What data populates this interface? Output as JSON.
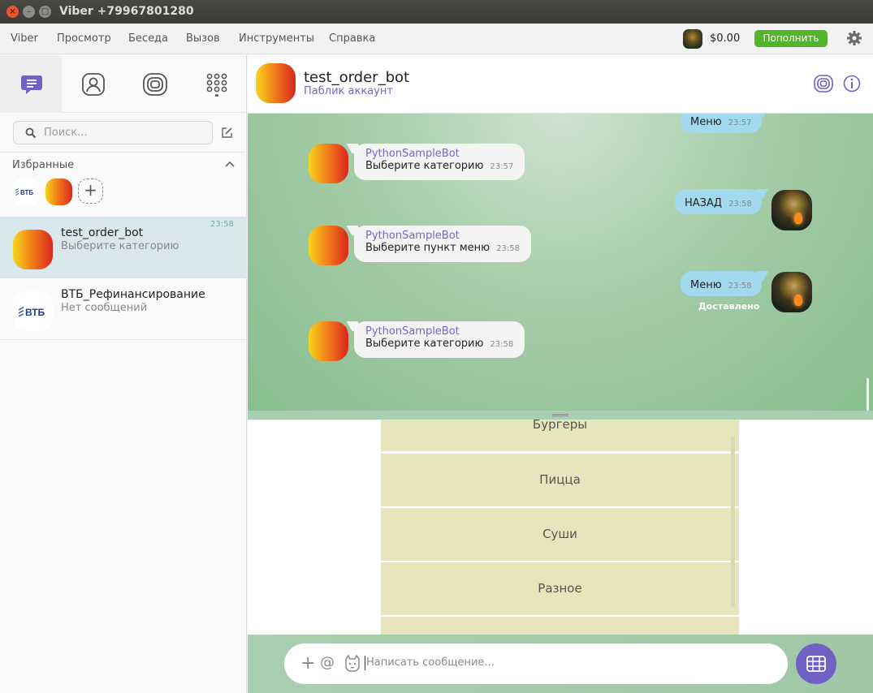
{
  "window": {
    "title": "Viber +79967801280"
  },
  "menu": {
    "items": [
      "Viber",
      "Просмотр",
      "Беседа",
      "Вызов",
      "Инструменты",
      "Справка"
    ],
    "balance": "$0.00",
    "topup_label": "Пополнить"
  },
  "sidebar": {
    "tabs": [
      {
        "icon": "chats-icon"
      },
      {
        "icon": "contacts-icon"
      },
      {
        "icon": "public-accounts-icon"
      },
      {
        "icon": "dialpad-icon"
      }
    ],
    "search_placeholder": "Поиск...",
    "favorites_label": "Избранные",
    "vtb_logo_text": "ВТБ",
    "chats": [
      {
        "name": "test_order_bot",
        "preview": "Выберите категорию",
        "time": "23:58",
        "active": true
      },
      {
        "name": "ВТБ_Рефинансирование",
        "preview": "Нет сообщений",
        "time": "",
        "active": false
      }
    ]
  },
  "chat": {
    "name": "test_order_bot",
    "subtitle": "Паблик аккаунт",
    "messages": [
      {
        "dir": "out",
        "text": "Меню",
        "time": "23:57"
      },
      {
        "dir": "in",
        "sender": "PythonSampleBot",
        "text": "Выберите категорию",
        "time": "23:57"
      },
      {
        "dir": "out",
        "text": "НАЗАД",
        "time": "23:58"
      },
      {
        "dir": "in",
        "sender": "PythonSampleBot",
        "text": "Выберите пункт меню",
        "time": "23:58"
      },
      {
        "dir": "out",
        "text": "Меню",
        "time": "23:58"
      },
      {
        "dir": "in",
        "sender": "PythonSampleBot",
        "text": "Выберите категорию",
        "time": "23:58"
      }
    ],
    "delivered_label": "Доставлено"
  },
  "keyboard": {
    "buttons": [
      "Бургеры",
      "Пицца",
      "Суши",
      "Разное",
      ""
    ]
  },
  "composer": {
    "placeholder": "Написать сообщение..."
  },
  "colors": {
    "accent": "#7360c4",
    "topup": "#52b52a",
    "outgoing_bubble": "#a3d9ee",
    "keyboard_button": "#e8e4bc"
  }
}
